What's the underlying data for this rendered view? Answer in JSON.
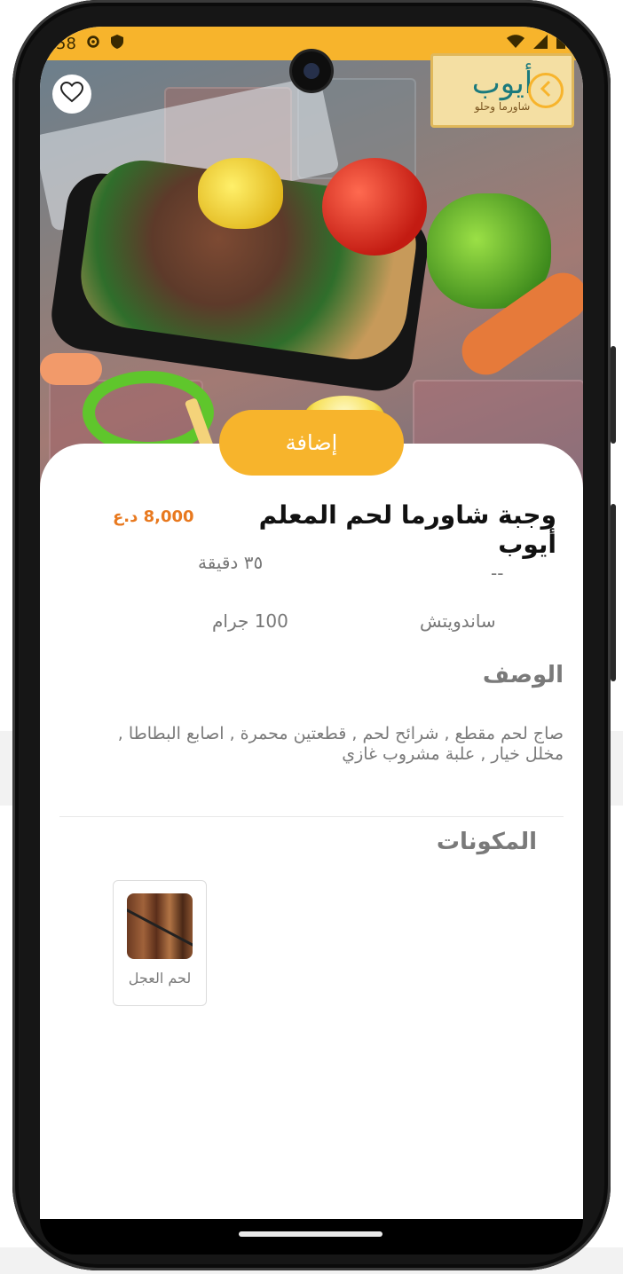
{
  "status_bar": {
    "time": "58",
    "icons": [
      "gear-icon",
      "shield-icon",
      "wifi-icon",
      "signal-icon",
      "battery-icon"
    ],
    "background": "#f7b42c"
  },
  "header": {
    "favorite_icon": "heart-outline-icon",
    "back_icon": "chevron-left-icon",
    "logo_title": "أيوب",
    "logo_subtitle": "شاورما وحلو"
  },
  "product": {
    "add_button_label": "إضافة",
    "title": "وجبة شاورما لحم المعلم أيوب",
    "price": "8,000 د.ع",
    "prep_time": "٣٥ دقيقة",
    "prep_placeholder": "--",
    "weight": "100 جرام",
    "category": "ساندويتش"
  },
  "description": {
    "heading": "الوصف",
    "text": "صاج لحم مقطع , شرائح لحم , قطعتين محمرة , اصابع البطاطا , مخلل خيار , علبة مشروب غازي"
  },
  "ingredients": {
    "heading": "المكونات",
    "items": [
      {
        "label": "لحم العجل"
      }
    ]
  },
  "colors": {
    "accent": "#f7b42c",
    "price": "#e8791f"
  }
}
